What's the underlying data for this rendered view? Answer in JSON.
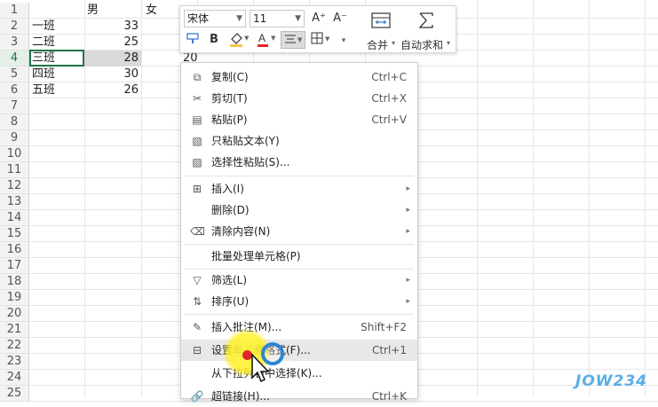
{
  "sheet": {
    "row_numbers": [
      "1",
      "2",
      "3",
      "4",
      "5",
      "6",
      "7",
      "8",
      "9",
      "10",
      "11",
      "12",
      "13",
      "14",
      "15",
      "16",
      "17",
      "18",
      "19",
      "20",
      "21",
      "22",
      "23",
      "24",
      "25"
    ],
    "headers": {
      "col_b": "男",
      "col_c": "女"
    },
    "rows": [
      {
        "name": "一班",
        "male": "33"
      },
      {
        "name": "二班",
        "male": "25"
      },
      {
        "name": "三班",
        "male": "28"
      },
      {
        "name": "四班",
        "male": "30"
      },
      {
        "name": "五班",
        "male": "26"
      }
    ],
    "editing_value": "20"
  },
  "toolbar": {
    "font_name": "宋体",
    "font_size": "11",
    "increase_font_icon": "A⁺",
    "decrease_font_icon": "A⁻",
    "bold": "B",
    "merge_label": "合并",
    "autosum_label": "自动求和",
    "colors": {
      "font_color": "#e0262b",
      "fill_color": "#f2c94c"
    }
  },
  "menu": {
    "items": [
      {
        "icon": "copy-icon",
        "label": "复制(C)",
        "shortcut": "Ctrl+C"
      },
      {
        "icon": "cut-icon",
        "label": "剪切(T)",
        "shortcut": "Ctrl+X"
      },
      {
        "icon": "paste-icon",
        "label": "粘贴(P)",
        "shortcut": "Ctrl+V"
      },
      {
        "icon": "paste-text-icon",
        "label": "只粘贴文本(Y)",
        "shortcut": ""
      },
      {
        "icon": "paste-special-icon",
        "label": "选择性粘贴(S)...",
        "shortcut": ""
      },
      {
        "icon": "insert-icon",
        "label": "插入(I)",
        "shortcut": ""
      },
      {
        "icon": "",
        "label": "删除(D)",
        "shortcut": ""
      },
      {
        "icon": "clear-icon",
        "label": "清除内容(N)",
        "shortcut": ""
      },
      {
        "icon": "",
        "label": "批量处理单元格(P)",
        "shortcut": ""
      },
      {
        "icon": "filter-icon",
        "label": "筛选(L)",
        "shortcut": ""
      },
      {
        "icon": "sort-icon",
        "label": "排序(U)",
        "shortcut": ""
      },
      {
        "icon": "comment-icon",
        "label": "插入批注(M)...",
        "shortcut": "Shift+F2"
      },
      {
        "icon": "format-cells-icon",
        "label": "设置单元格格式(F)...",
        "shortcut": "Ctrl+1"
      },
      {
        "icon": "",
        "label": "从下拉列表中选择(K)...",
        "shortcut": ""
      },
      {
        "icon": "link-icon",
        "label": "超链接(H)...",
        "shortcut": "Ctrl+K"
      }
    ]
  },
  "watermark": "JOW234"
}
